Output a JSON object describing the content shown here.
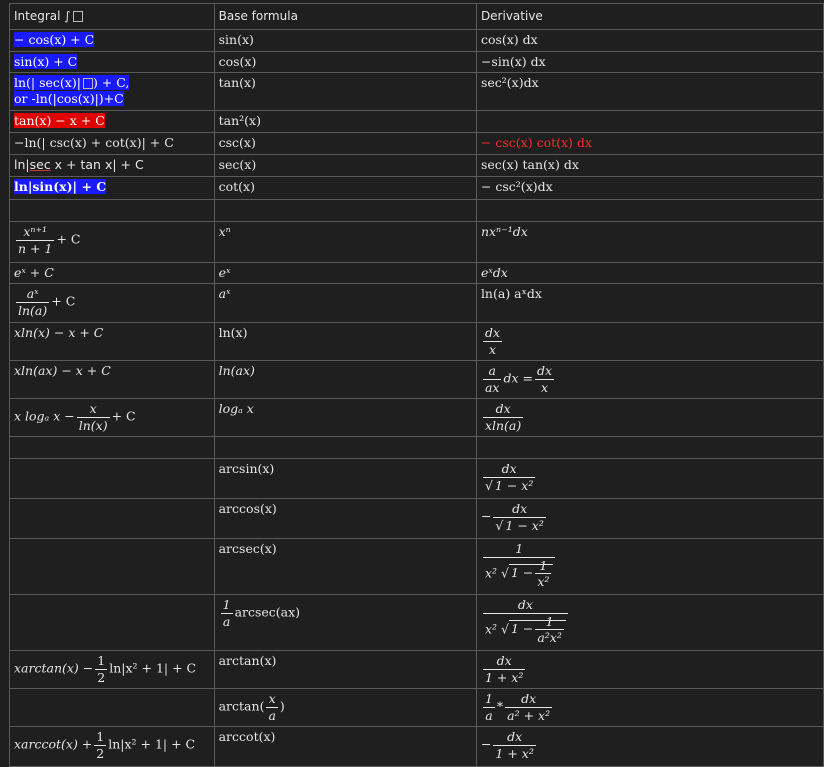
{
  "headers": {
    "col1": "Integral ∫",
    "col2": "Base formula",
    "col3": "Derivative"
  },
  "rows": {
    "sin": {
      "integral": "− cos(x) + C",
      "base": "sin(x)",
      "derivative": "cos(x) dx"
    },
    "cos": {
      "integral": "sin(x) + C",
      "base": "cos(x)",
      "derivative": "−sin(x) dx"
    },
    "tan": {
      "integral_line1": "ln(| sec(x)|",
      "integral_line1b": ") + C,",
      "integral_line2": "or -ln(|cos(x)|)+C",
      "base": "tan(x)",
      "derivative": "sec²(x)dx"
    },
    "tan2": {
      "integral": "tan(x) − x + C",
      "base": "tan²(x)",
      "derivative": ""
    },
    "csc": {
      "integral": "−ln(| csc(x) + cot(x)| + C",
      "base": "csc(x)",
      "derivative": "− csc(x) cot(x) dx"
    },
    "sec": {
      "integral_pre": "ln",
      "integral_under": "|sec",
      "integral_post": " x + tan x| + C",
      "base": "sec(x)",
      "derivative": "sec(x) tan(x) dx"
    },
    "cot": {
      "integral": "ln|sin(x)| + C",
      "base": "cot(x)",
      "derivative": "− csc²(x)dx"
    },
    "power": {
      "int_num": "xⁿ⁺¹",
      "int_den": "n + 1",
      "int_tail": "+ C",
      "base": "xⁿ",
      "derivative": "nxⁿ⁻¹dx"
    },
    "exp": {
      "integral": "eˣ + C",
      "base": "eˣ",
      "derivative": "eˣdx"
    },
    "aexp": {
      "int_num": "aˣ",
      "int_den": "ln(a)",
      "int_tail": "+ C",
      "base": "aˣ",
      "derivative": "ln(a) aˣdx"
    },
    "ln": {
      "integral": "xln(x) − x + C",
      "base": "ln(x)",
      "der_num": "dx",
      "der_den": "x"
    },
    "lnax": {
      "integral": "xln(ax) − x + C",
      "base": "ln(ax)",
      "der_num1": "a",
      "der_den1": "ax",
      "der_mid": "dx =",
      "der_num2": "dx",
      "der_den2": "x"
    },
    "log": {
      "int_pre": "x logₐ x −",
      "int_num": "x",
      "int_den": "ln(x)",
      "int_tail": "+ C",
      "base": "logₐ x",
      "der_num": "dx",
      "der_den": "xln(a)"
    },
    "arcsin": {
      "base": "arcsin(x)",
      "der_num": "dx",
      "der_den_pre": "√",
      "der_den": "1 − x²"
    },
    "arccos": {
      "base": "arccos(x)",
      "der_sign": "−",
      "der_num": "dx",
      "der_den_pre": "√",
      "der_den": "1 − x²"
    },
    "arcsec": {
      "base": "arcsec(x)",
      "der_num": "1",
      "der_den_pre": "x² √",
      "der_den_in1": "1 −",
      "der_den_num": "1",
      "der_den_den": "x²"
    },
    "arcsecax": {
      "base_num": "1",
      "base_den": "a",
      "base_tail": "arcsec(ax)",
      "der_num": "dx",
      "der_den_pre": "x² √",
      "der_den_in1": "1 −",
      "der_den_num": "1",
      "der_den_den": "a²x²"
    },
    "arctan": {
      "int_pre": "xarctan(x) −",
      "int_num": "1",
      "int_den": "2",
      "int_tail": "ln|x² + 1| + C",
      "base": "arctan(x)",
      "der_num": "dx",
      "der_den": "1 + x²"
    },
    "arctanxa": {
      "base_pre": "arctan(",
      "base_num": "x",
      "base_den": "a",
      "base_post": ")",
      "der_num1": "1",
      "der_den1": "a",
      "der_mid": "*",
      "der_num2": "dx",
      "der_den2": "a² + x²"
    },
    "arccot": {
      "int_pre": "xarccot(x) +",
      "int_num": "1",
      "int_den": "2",
      "int_tail": "ln|x² + 1| + C",
      "base": "arccot(x)",
      "der_sign": "−",
      "der_num": "dx",
      "der_den": "1 + x²"
    }
  },
  "colors": {
    "highlight_blue": "#1a1aff",
    "highlight_red": "#e00000",
    "red_text": "#ff2a2a"
  }
}
